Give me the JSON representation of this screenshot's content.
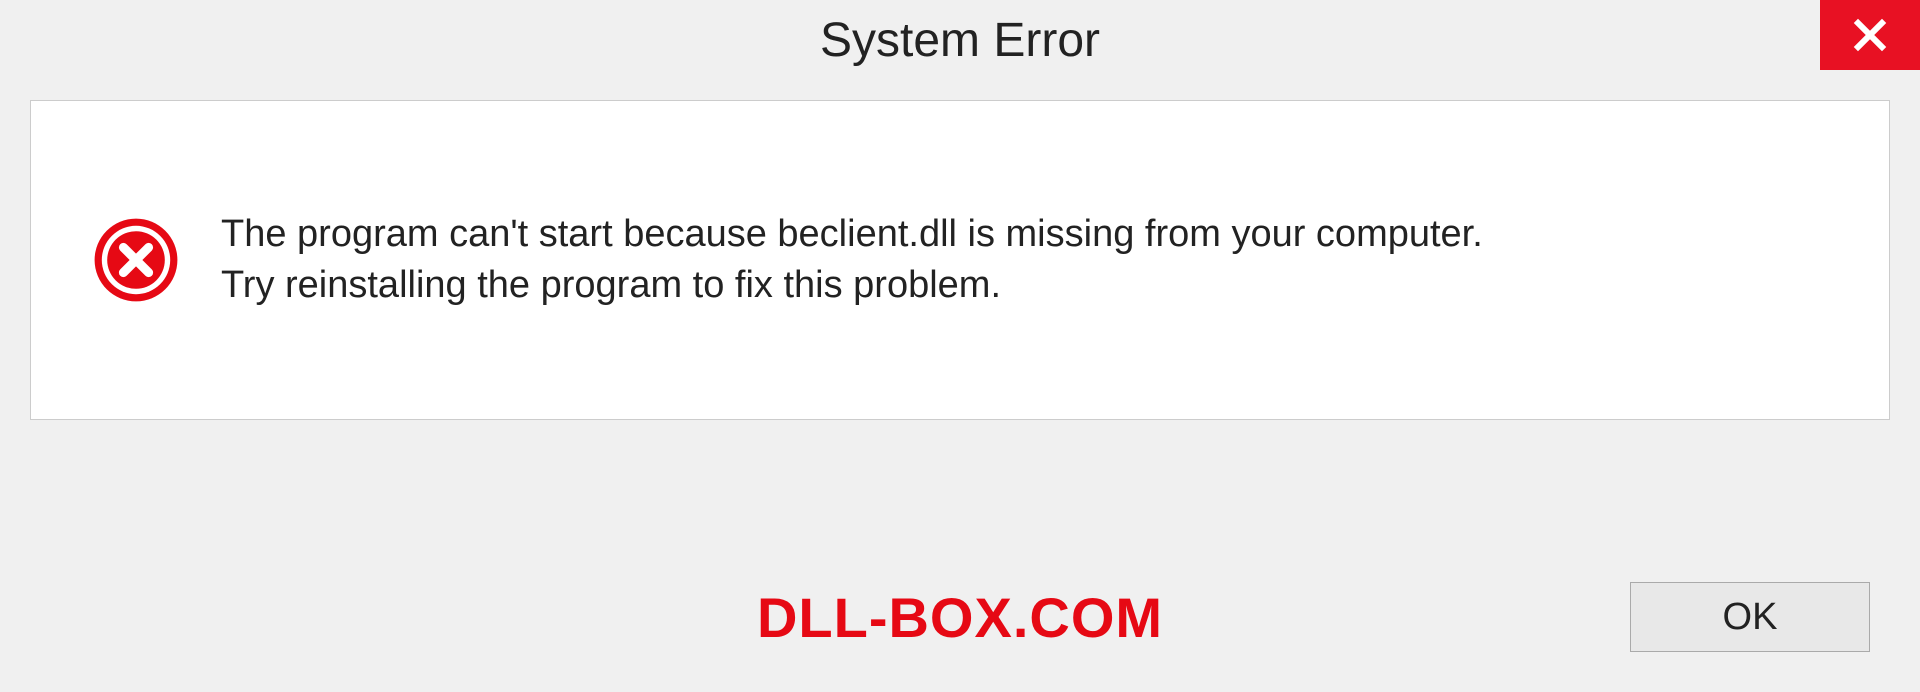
{
  "dialog": {
    "title": "System Error",
    "message_line1": "The program can't start because beclient.dll is missing from your computer.",
    "message_line2": "Try reinstalling the program to fix this problem.",
    "ok_label": "OK"
  },
  "watermark": "DLL-BOX.COM"
}
